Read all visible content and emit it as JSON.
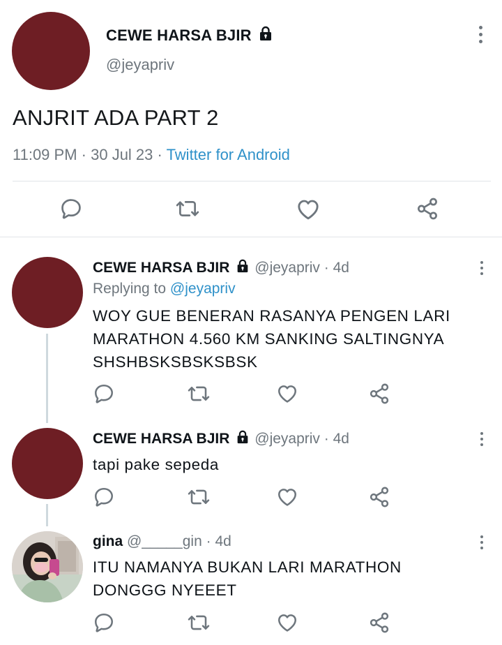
{
  "main_tweet": {
    "display_name": "CEWE HARSA BJIR",
    "handle": "@jeyapriv",
    "text": "ANJRIT ADA PART 2",
    "time": "11:09 PM",
    "date": "30 Jul 23",
    "source": "Twitter for Android",
    "separator": " · ",
    "avatar_color": "#6e1e24"
  },
  "replies": [
    {
      "display_name": "CEWE HARSA BJIR",
      "handle": "@jeyapriv",
      "age": "4d",
      "replying_label": "Replying to",
      "replying_to": "@jeyapriv",
      "text_lines": [
        "WOY GUE BENERAN RASANYA PENGEN LARI",
        "MARATHON 4.560 KM SANKING SALTINGNYA",
        "SHSHBSKSBSKSBSK"
      ],
      "avatar_color": "#6e1e24"
    },
    {
      "display_name": "CEWE HARSA BJIR",
      "handle": "@jeyapriv",
      "age": "4d",
      "text_lines": [
        "tapi pake sepeda"
      ],
      "avatar_color": "#6e1e24"
    },
    {
      "display_name": "gina",
      "handle": "@_____gin",
      "age": "4d",
      "text_lines": [
        "ITU NAMANYA BUKAN LARI MARATHON",
        "DONGGG NYEEET"
      ]
    }
  ],
  "colors": {
    "link_blue": "#1d9bf0",
    "secondary_gray": "#6e767d",
    "divider": "#e1e5e8"
  },
  "icons": [
    "reply-icon",
    "retweet-icon",
    "like-icon",
    "share-icon",
    "lock-icon",
    "more-options-icon"
  ]
}
